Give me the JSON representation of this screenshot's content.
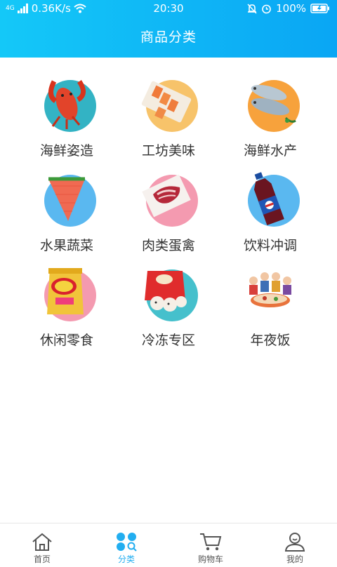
{
  "status_bar": {
    "signal": "4G",
    "speed": "0.36K/s",
    "time": "20:30",
    "battery": "100%"
  },
  "header": {
    "title": "商品分类"
  },
  "categories": [
    {
      "label": "海鲜姿造",
      "icon": "lobster-icon"
    },
    {
      "label": "工坊美味",
      "icon": "salmon-icon"
    },
    {
      "label": "海鲜水产",
      "icon": "fish-icon"
    },
    {
      "label": "水果蔬菜",
      "icon": "watermelon-icon"
    },
    {
      "label": "肉类蛋禽",
      "icon": "meat-icon"
    },
    {
      "label": "饮料冲调",
      "icon": "soda-bottle-icon"
    },
    {
      "label": "休闲零食",
      "icon": "chips-icon"
    },
    {
      "label": "冷冻专区",
      "icon": "dumplings-icon"
    },
    {
      "label": "年夜饭",
      "icon": "family-dinner-icon"
    }
  ],
  "tabbar": {
    "active": "分类",
    "items": [
      {
        "label": "首页",
        "icon": "home-icon"
      },
      {
        "label": "分类",
        "icon": "category-icon"
      },
      {
        "label": "购物车",
        "icon": "cart-icon"
      },
      {
        "label": "我的",
        "icon": "user-icon"
      }
    ]
  },
  "colors": {
    "header_start": "#14c8f8",
    "header_end": "#0aa6f4",
    "active_tab": "#22aef0"
  }
}
